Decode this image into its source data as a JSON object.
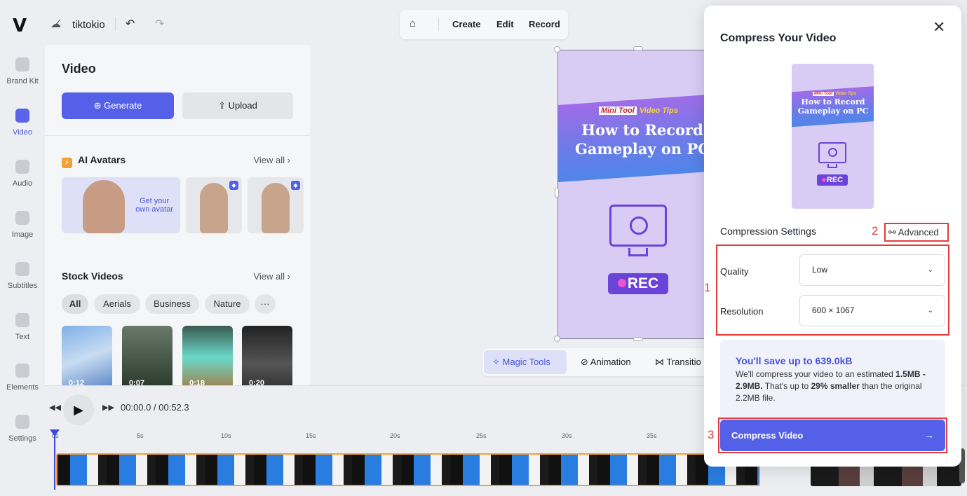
{
  "topbar": {
    "project_name": "tiktokio",
    "modes": [
      "Create",
      "Edit",
      "Record"
    ]
  },
  "rail": [
    {
      "label": "Brand Kit",
      "icon": "brand-kit-icon"
    },
    {
      "label": "Video",
      "icon": "video-icon",
      "active": true
    },
    {
      "label": "Audio",
      "icon": "audio-icon"
    },
    {
      "label": "Image",
      "icon": "image-icon"
    },
    {
      "label": "Subtitles",
      "icon": "subtitles-icon"
    },
    {
      "label": "Text",
      "icon": "text-icon"
    },
    {
      "label": "Elements",
      "icon": "elements-icon"
    },
    {
      "label": "Settings",
      "icon": "settings-icon"
    }
  ],
  "panel": {
    "title": "Video",
    "generate_label": "Generate",
    "upload_label": "Upload",
    "ai_avatars": {
      "title": "AI Avatars",
      "view_all": "View all",
      "own_avatar_line1": "Get your",
      "own_avatar_line2": "own avatar"
    },
    "stock_videos": {
      "title": "Stock Videos",
      "view_all": "View all",
      "chips": [
        "All",
        "Aerials",
        "Business",
        "Nature",
        "···"
      ],
      "thumbs": [
        {
          "duration": "0:12"
        },
        {
          "duration": "0:07"
        },
        {
          "duration": "0:18"
        },
        {
          "duration": "0:20"
        }
      ]
    }
  },
  "canvas": {
    "video": {
      "brand_logo": "Mini Tool",
      "brand_tag": "Video Tips",
      "title": "How to Record Gameplay on PC",
      "rec": "REC"
    },
    "context_bar": {
      "magic": "Magic Tools",
      "animation": "Animation",
      "transition": "Transitio"
    }
  },
  "timeline": {
    "current": "00:00.0",
    "separator": "/",
    "total": "00:52.3",
    "ticks": [
      "0s",
      "5s",
      "10s",
      "15s",
      "20s",
      "25s",
      "30s",
      "35s"
    ]
  },
  "modal": {
    "title": "Compress Your Video",
    "preview": {
      "brand_logo": "Mini Tool",
      "brand_tag": "Video Tips",
      "title": "How to Record Gameplay on PC",
      "rec": "REC"
    },
    "settings_title": "Compression Settings",
    "advanced": "Advanced",
    "quality_label": "Quality",
    "quality_value": "Low",
    "resolution_label": "Resolution",
    "resolution_value": "600 × 1067",
    "save_title": "You'll save up to 639.0kB",
    "save_desc_1": "We'll compress your video to an estimated ",
    "save_desc_range": "1.5MB - 2.9MB.",
    "save_desc_2": " That's up to ",
    "save_desc_pct": "29% smaller",
    "save_desc_3": " than the original 2.2MB file.",
    "compress_button": "Compress Video",
    "annotations": [
      "1",
      "2",
      "3"
    ]
  },
  "colors": {
    "accent": "#5560e8",
    "annotation": "#e23b3b",
    "track_border": "#f0a13a"
  }
}
